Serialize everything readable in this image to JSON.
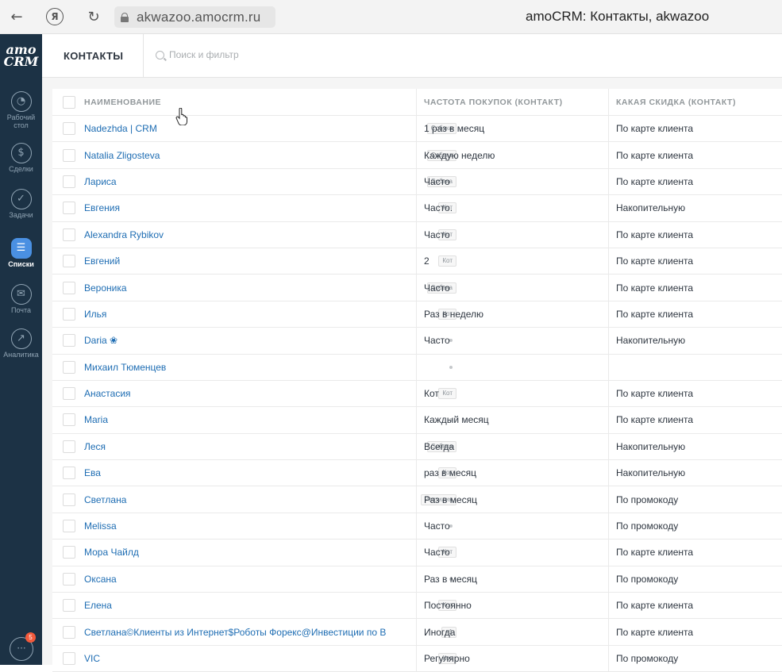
{
  "browser": {
    "url": "akwazoo.amocrm.ru",
    "tab_title": "amoCRM: Контакты, akwazoo",
    "back_icon": "back-arrow-icon",
    "yandex_icon": "yandex-icon",
    "reload_icon": "reload-icon"
  },
  "sidebar": {
    "logo_line1": "amo",
    "logo_line2": "CRM",
    "items": [
      {
        "label": "Рабочий стол",
        "icon": "dashboard-icon"
      },
      {
        "label": "Сделки",
        "icon": "dollar-icon"
      },
      {
        "label": "Задачи",
        "icon": "check-icon"
      },
      {
        "label": "Списки",
        "icon": "lists-icon",
        "active": true
      },
      {
        "label": "Почта",
        "icon": "mail-icon"
      },
      {
        "label": "Аналитика",
        "icon": "analytics-icon"
      }
    ],
    "chat_badge": "5"
  },
  "header": {
    "title": "КОНТАКТЫ",
    "search_placeholder": "Поиск и фильтр"
  },
  "table": {
    "columns": [
      "НАИМЕНОВАНИЕ",
      "ЧАСТОТА ПОКУПОК (КОНТАКТ)",
      "КАКАЯ СКИДКА (КОНТАКТ)"
    ],
    "rows": [
      {
        "name": "Nadezhda | CRM",
        "tag": "Собака",
        "freq": "1 раз в месяц",
        "disc": "По карте клиента"
      },
      {
        "name": "Natalia Zligosteva",
        "tag": "Собака",
        "freq": "Каждую неделю",
        "disc": "По карте клиента"
      },
      {
        "name": "Лариса",
        "tag": "Собака",
        "freq": "Часто",
        "disc": "По карте клиента"
      },
      {
        "name": "Евгения",
        "tag": "Кот",
        "freq": "Часто.",
        "disc": "Накопительную"
      },
      {
        "name": "Alexandra Rybikov",
        "tag": "Кот",
        "freq": "Часто",
        "disc": "По карте клиента"
      },
      {
        "name": "Евгений",
        "tag": "Кот",
        "freq": "2",
        "disc": "По карте клиента"
      },
      {
        "name": "Вероника",
        "tag": "Собака",
        "freq": "Часто",
        "disc": "По карте клиента"
      },
      {
        "name": "Илья",
        "tag": "Кот",
        "freq": "Раз в неделю",
        "disc": "По карте клиента"
      },
      {
        "name": "Daria ❀",
        "tag": "",
        "freq": "Часто",
        "disc": "Накопительную"
      },
      {
        "name": "Михаил Тюменцев",
        "tag": "",
        "freq": "",
        "disc": ""
      },
      {
        "name": "Анастасия",
        "tag": "Кот",
        "freq": "Кот",
        "disc": "По карте клиента"
      },
      {
        "name": "Maria",
        "tag": "",
        "freq": "Каждый месяц",
        "disc": "По карте клиента"
      },
      {
        "name": "Леся",
        "tag": "Собака",
        "freq": "Всегда",
        "disc": "Накопительную"
      },
      {
        "name": "Ева",
        "tag": "Кот",
        "freq": "раз в месяц",
        "disc": "Накопительную"
      },
      {
        "name": "Светлана",
        "tag": "Рептилия",
        "freq": "Раз в месяц",
        "disc": "По промокоду"
      },
      {
        "name": "Melissa",
        "tag": "",
        "freq": "Часто",
        "disc": "По промокоду"
      },
      {
        "name": "Мора Чайлд",
        "tag": "Кот",
        "freq": "Часто",
        "disc": "По карте клиента"
      },
      {
        "name": "Оксана",
        "tag": "",
        "freq": "Раз в месяц",
        "disc": "По промокоду"
      },
      {
        "name": "Елена",
        "tag": "Кот",
        "freq": "Постоянно",
        "disc": "По карте клиента"
      },
      {
        "name": "Светлана©Клиенты из Интернет$Роботы Форекс@Инвестиции по В",
        "tag": "+1",
        "freq": "Иногда",
        "disc": "По карте клиента"
      },
      {
        "name": "VIC",
        "tag": "Кот",
        "freq": "Регулярно",
        "disc": "По промокоду"
      }
    ]
  }
}
